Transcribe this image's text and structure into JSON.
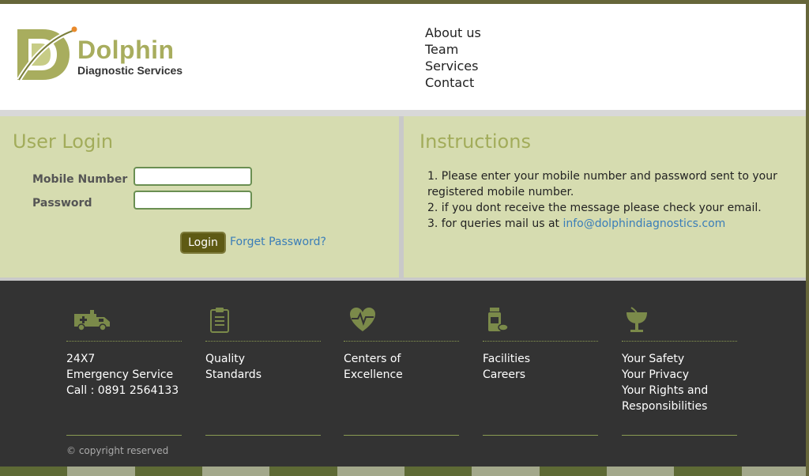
{
  "brand": {
    "name": "Dolphin",
    "subtitle": "Diagnostic Services"
  },
  "nav": [
    "About us",
    "Team",
    "Services",
    "Contact"
  ],
  "login": {
    "title": "User Login",
    "mobile_label": "Mobile Number",
    "password_label": "Password",
    "mobile_value": "",
    "password_value": "",
    "login_button": "Login",
    "forgot_link": "Forget Password?"
  },
  "instructions": {
    "title": "Instructions",
    "item1": "1. Please enter your mobile number and password sent to your registered mobile number.",
    "item2": "2. if you dont receive the message please check your email.",
    "item3_prefix": "3. for queries mail us at ",
    "item3_email": "info@dolphindiagnostics.com"
  },
  "footer": {
    "columns": [
      {
        "icon": "ambulance-icon",
        "lines": [
          "24X7",
          "Emergency Service",
          "Call : 0891 2564133"
        ]
      },
      {
        "icon": "clipboard-icon",
        "lines": [
          "Quality",
          "Standards"
        ]
      },
      {
        "icon": "heartbeat-icon",
        "lines": [
          "Centers of",
          "Excellence"
        ]
      },
      {
        "icon": "medicine-icon",
        "lines": [
          "Facilities",
          "Careers"
        ]
      },
      {
        "icon": "pharmacy-icon",
        "lines": [
          "Your Safety",
          "Your Privacy",
          "Your Rights and",
          "Responsibilities"
        ]
      }
    ],
    "copyright": "© copyright reserved"
  },
  "colors": {
    "accent": "#a2ac5a",
    "panel": "#d6dcb0",
    "footer": "#333333",
    "button": "#5e5a14",
    "link": "#3a7db8"
  }
}
